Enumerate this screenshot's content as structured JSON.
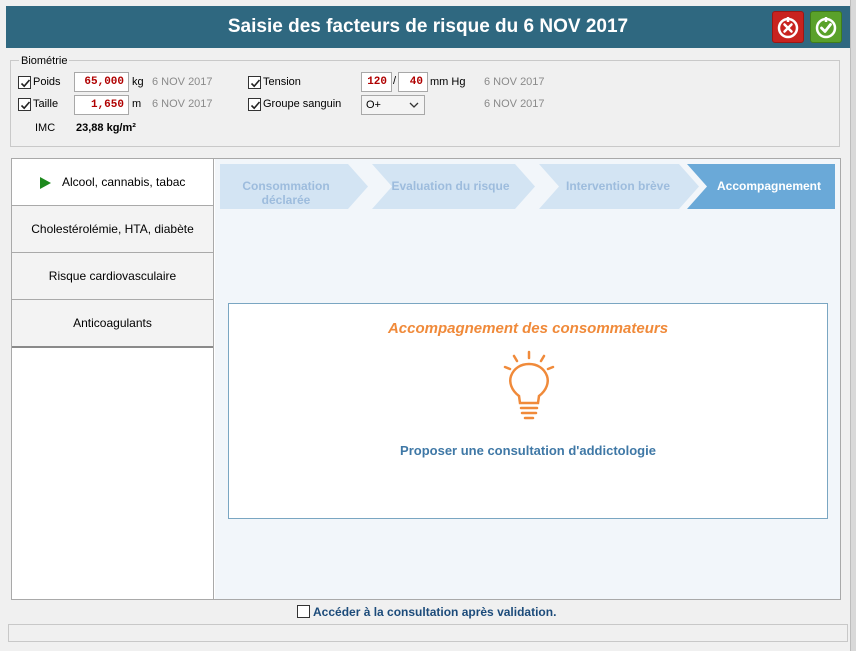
{
  "window": {
    "title": "Saisie des facteurs de risque du 6 NOV 2017",
    "cancel_icon": "cancel-icon",
    "validate_icon": "validate-icon"
  },
  "biometrie": {
    "legend": "Biométrie",
    "poids": {
      "label": "Poids",
      "value": "65,000",
      "unit": "kg",
      "date": "6 NOV 2017",
      "checked": true
    },
    "taille": {
      "label": "Taille",
      "value": "1,650",
      "unit": "m",
      "date": "6 NOV 2017",
      "checked": true
    },
    "imc": {
      "label": "IMC",
      "value": "23,88 kg/m²"
    },
    "tension": {
      "label": "Tension",
      "systolic": "120",
      "separator": "/",
      "diastolic": "40",
      "unit": "mm Hg",
      "date": "6 NOV 2017",
      "checked": true
    },
    "groupe": {
      "label": "Groupe sanguin",
      "value": "O+",
      "date": "6 NOV 2017",
      "checked": true
    }
  },
  "sidebar": {
    "items": [
      {
        "label": "Alcool, cannabis, tabac",
        "active": true
      },
      {
        "label": "Cholestérolémie, HTA, diabète",
        "active": false
      },
      {
        "label": "Risque cardiovasculaire",
        "active": false
      },
      {
        "label": "Anticoagulants",
        "active": false
      }
    ]
  },
  "steps": [
    {
      "label": "Consommation déclarée",
      "active": false
    },
    {
      "label": "Evaluation du risque",
      "active": false
    },
    {
      "label": "Intervention brève",
      "active": false
    },
    {
      "label": "Accompagnement",
      "active": true
    }
  ],
  "card": {
    "title": "Accompagnement des consommateurs",
    "icon": "lightbulb-icon",
    "text": "Proposer une consultation d'addictologie"
  },
  "footer": {
    "checkbox_label": "Accéder à la consultation après validation.",
    "checked": false
  },
  "colors": {
    "title_bar": "#2f6880",
    "step_inactive": "#d3e4f3",
    "step_active": "#6aa9d8",
    "accent_orange": "#f08a3a",
    "text_blue": "#3f78a6"
  }
}
